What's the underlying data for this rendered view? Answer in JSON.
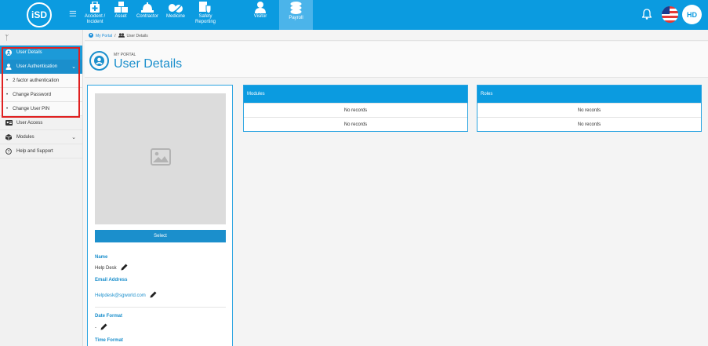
{
  "app": {
    "logo_text": "iSD"
  },
  "topnav": {
    "items": [
      {
        "label": "Accident / Incident",
        "icon": "first-aid-icon"
      },
      {
        "label": "Asset",
        "icon": "boxes-icon"
      },
      {
        "label": "Contractor",
        "icon": "hardhat-icon"
      },
      {
        "label": "Medicine",
        "icon": "pills-icon"
      },
      {
        "label": "Safety Reporting",
        "icon": "shield-report-icon"
      },
      {
        "label": "Visitor",
        "icon": "person-icon"
      },
      {
        "label": "Payroll",
        "icon": "coins-icon"
      }
    ],
    "active": "Payroll",
    "user_initials": "HD"
  },
  "sidebar": {
    "items": [
      {
        "label": "User Details",
        "icon": "user-circle-icon"
      },
      {
        "label": "User Authentication",
        "icon": "user-shield-icon"
      },
      {
        "label": "2 factor authentication"
      },
      {
        "label": "Change Password"
      },
      {
        "label": "Change User PIN"
      },
      {
        "label": "User Access",
        "icon": "id-card-icon"
      },
      {
        "label": "Modules",
        "icon": "cube-icon"
      },
      {
        "label": "Help and Support",
        "icon": "question-icon"
      }
    ]
  },
  "breadcrumb": {
    "items": [
      "My Portal",
      "User Details"
    ]
  },
  "header": {
    "subtitle": "MY PORTAL",
    "title": "User Details"
  },
  "profile": {
    "select_label": "Select",
    "name_label": "Name",
    "name_value": "Help Desk",
    "email_label": "Email Address",
    "email_value": "Helpdesk@sgworld.com",
    "date_format_label": "Date Format",
    "date_format_value": "-",
    "time_format_label": "Time Format"
  },
  "modules_panel": {
    "title": "Modules",
    "rows": [
      "No records",
      "No records"
    ]
  },
  "roles_panel": {
    "title": "Roles",
    "rows": [
      "No records",
      "No records"
    ]
  },
  "colors": {
    "primary": "#0b9be0",
    "accent": "#1b8fcc",
    "highlight": "#e02020"
  }
}
